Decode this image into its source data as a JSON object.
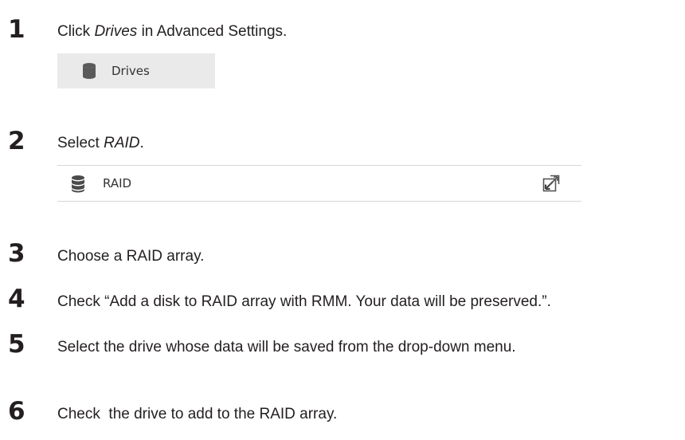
{
  "steps": [
    {
      "number": "1",
      "text_before": "Click ",
      "text_em": "Drives",
      "text_after": " in Advanced Settings."
    },
    {
      "number": "2",
      "text_before": "Select ",
      "text_em": "RAID",
      "text_after": "."
    },
    {
      "number": "3",
      "text": "Choose a RAID array."
    },
    {
      "number": "4",
      "text": "Check “Add a disk to RAID array with RMM. Your data will be preserved.”."
    },
    {
      "number": "5",
      "text": "Select the drive whose data will be saved from the drop-down menu."
    },
    {
      "number": "6",
      "text": "Check  the drive to add to the RAID array."
    }
  ],
  "drives_button": {
    "label": "Drives",
    "icon": "database-icon",
    "background": "#eaeaea"
  },
  "raid_row": {
    "label": "RAID",
    "icon": "database-icon",
    "action_icon": "expand-icon"
  }
}
